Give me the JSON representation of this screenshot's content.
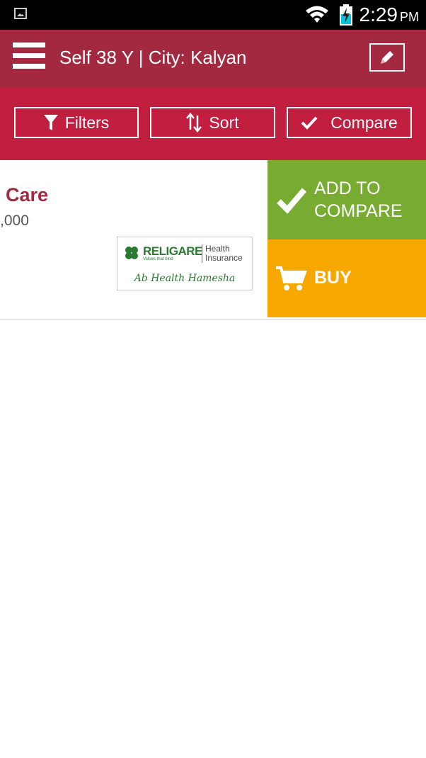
{
  "status_bar": {
    "time": "2:29",
    "ampm": "PM",
    "icons": [
      "image-icon",
      "wifi-icon",
      "battery-charging-icon"
    ]
  },
  "app_bar": {
    "title": "Self 38 Y | City: Kalyan",
    "icons": [
      "menu-icon",
      "pencil-icon"
    ]
  },
  "toolbar": {
    "filters_label": "Filters",
    "sort_label": "Sort",
    "compare_label": "Compare",
    "icons": [
      "filter-icon",
      "sort-icon",
      "check-icon"
    ]
  },
  "plan_card": {
    "name": "Care",
    "sum_insured": ",000",
    "logo": {
      "brand": "RELIGARE",
      "tagline": "Values that bind",
      "product": "Health Insurance",
      "slogan": "Ab Health Hamesha"
    },
    "add_to_compare_label": "ADD TO COMPARE",
    "buy_label": "BUY"
  },
  "colors": {
    "app_bar": "#a32940",
    "toolbar": "#c21e3f",
    "compare_green": "#77ab31",
    "buy_orange": "#f6a800",
    "plan_name": "#a32940"
  }
}
